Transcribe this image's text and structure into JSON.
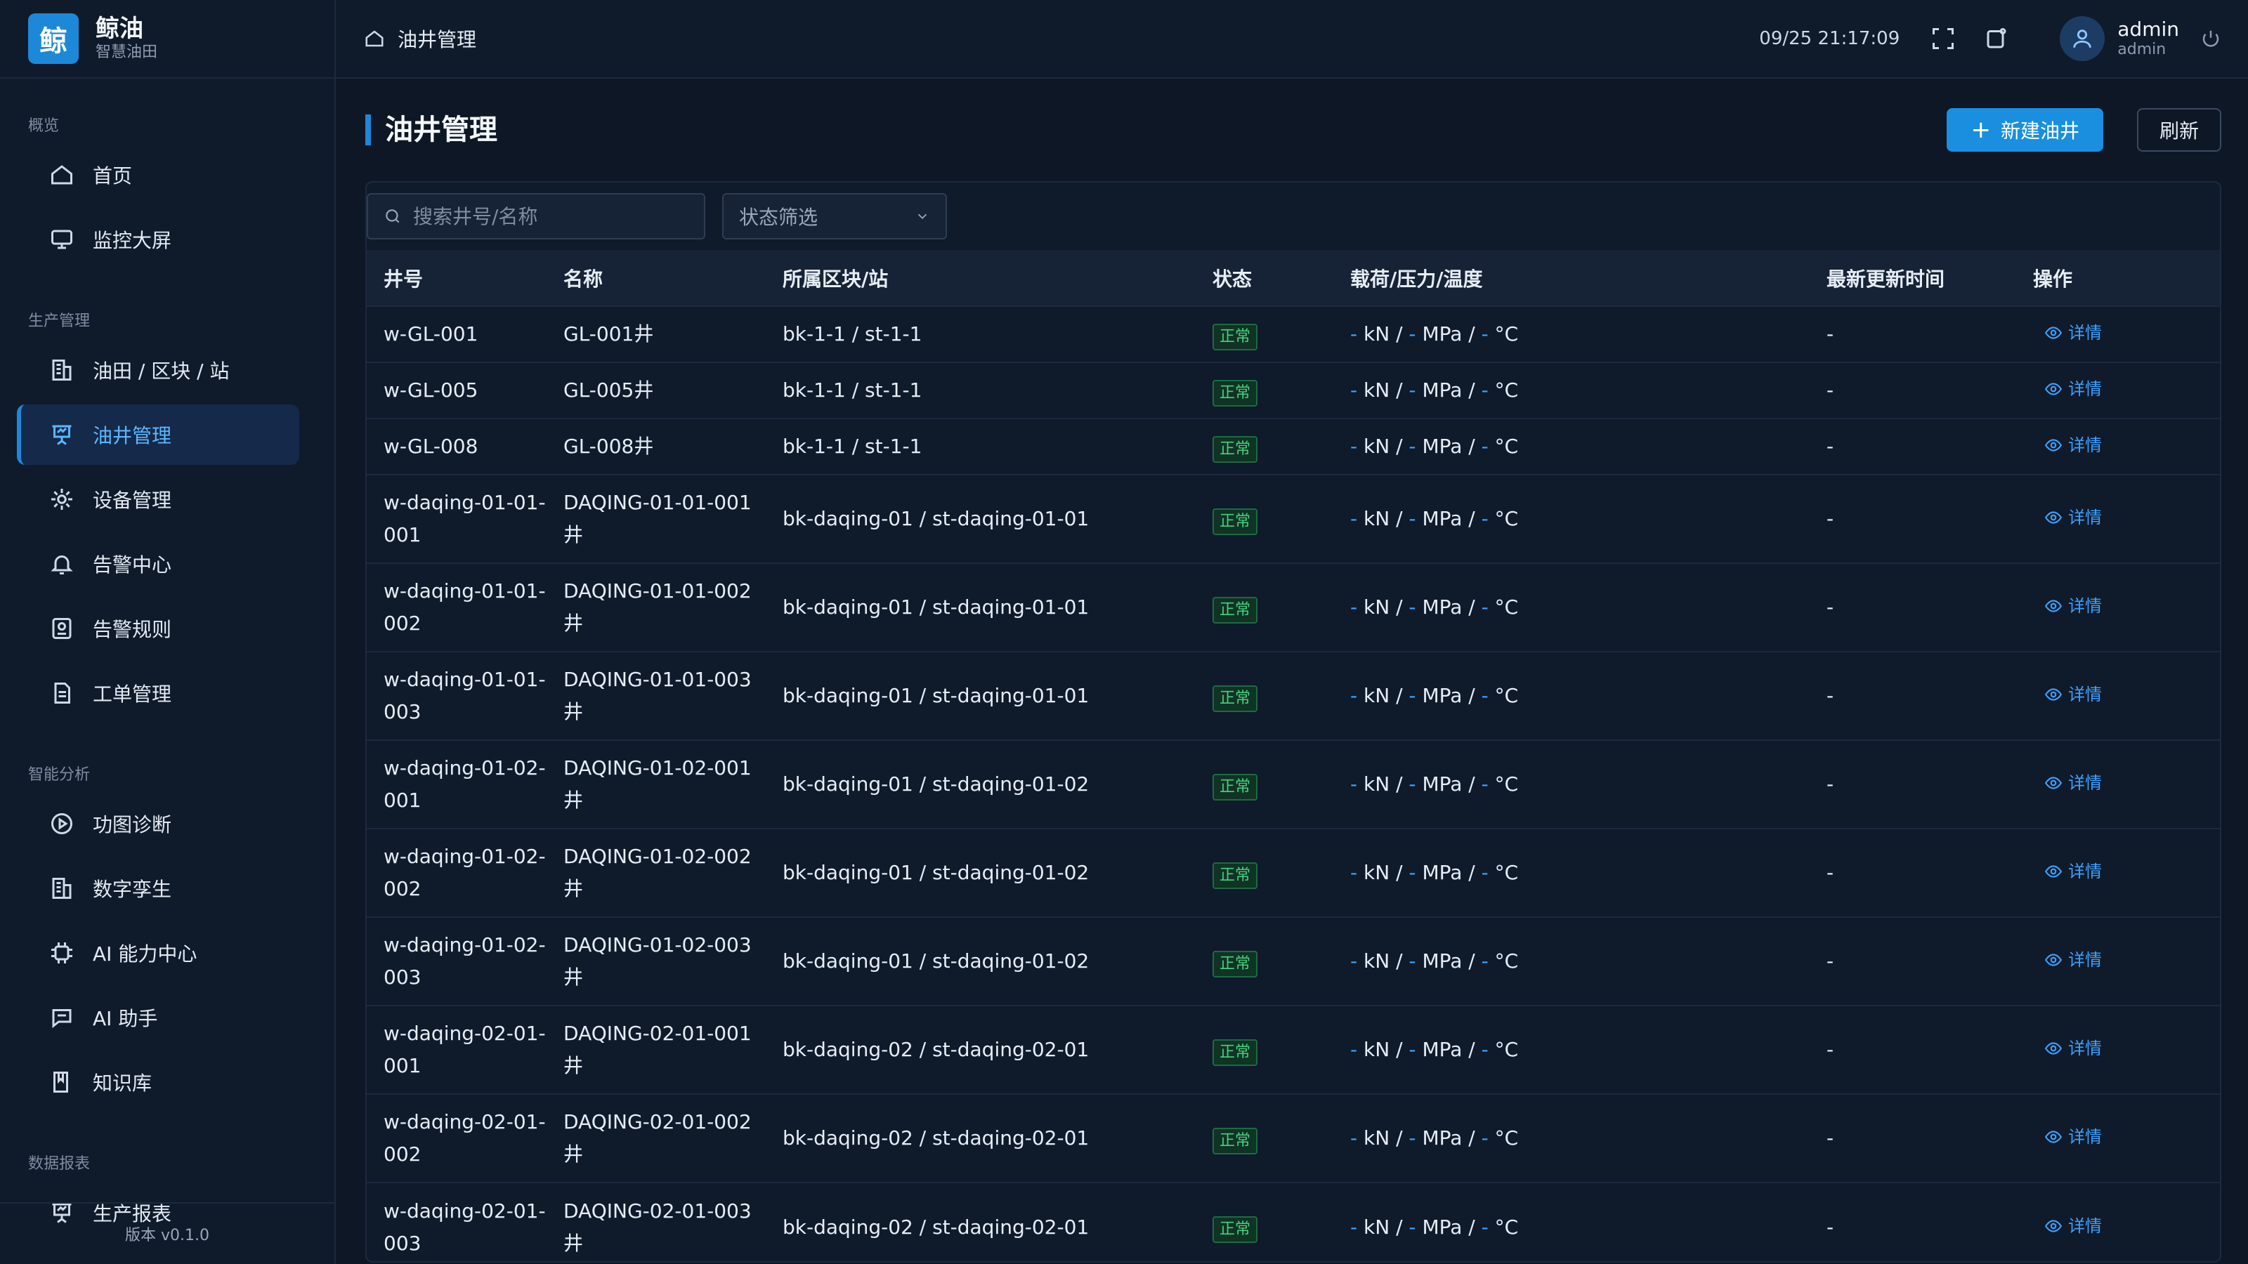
{
  "brand": {
    "logo": "鲸",
    "name": "鲸油",
    "subtitle": "智慧油田"
  },
  "sidebar": {
    "groups": [
      {
        "title": "概览",
        "items": [
          {
            "label": "首页",
            "icon": "home-icon"
          },
          {
            "label": "监控大屏",
            "icon": "monitor-icon"
          }
        ]
      },
      {
        "title": "生产管理",
        "items": [
          {
            "label": "油田 / 区块 / 站",
            "icon": "building-icon"
          },
          {
            "label": "油井管理",
            "icon": "presentation-icon",
            "active": true
          },
          {
            "label": "设备管理",
            "icon": "gear-icon"
          },
          {
            "label": "告警中心",
            "icon": "bell-icon"
          },
          {
            "label": "告警规则",
            "icon": "rules-icon"
          },
          {
            "label": "工单管理",
            "icon": "document-icon"
          }
        ]
      },
      {
        "title": "智能分析",
        "items": [
          {
            "label": "功图诊断",
            "icon": "play-circle-icon"
          },
          {
            "label": "数字孪生",
            "icon": "building-icon"
          },
          {
            "label": "AI 能力中心",
            "icon": "chip-icon"
          },
          {
            "label": "AI 助手",
            "icon": "chat-icon"
          },
          {
            "label": "知识库",
            "icon": "book-icon"
          }
        ]
      },
      {
        "title": "数据报表",
        "items": [
          {
            "label": "生产报表",
            "icon": "presentation-icon"
          }
        ]
      }
    ],
    "version": "版本 v0.1.0"
  },
  "topbar": {
    "breadcrumb": "油井管理",
    "clock": "09/25 21:17:09",
    "user_name": "admin",
    "user_role": "admin"
  },
  "page": {
    "title": "油井管理",
    "new_button": "新建油井",
    "refresh_button": "刷新",
    "search_placeholder": "搜索井号/名称",
    "status_filter": "状态筛选"
  },
  "table": {
    "headers": [
      "井号",
      "名称",
      "所属区块/站",
      "状态",
      "载荷/压力/温度",
      "最新更新时间",
      "操作"
    ],
    "metric": {
      "dash": "-",
      "kn": "kN /",
      "mpa": "MPa /",
      "c": "°C"
    },
    "detail_label": "详情",
    "rows": [
      {
        "id": "w-GL-001",
        "name": "GL-001井",
        "station": "bk-1-1 / st-1-1",
        "status": "正常",
        "updated": "-"
      },
      {
        "id": "w-GL-005",
        "name": "GL-005井",
        "station": "bk-1-1 / st-1-1",
        "status": "正常",
        "updated": "-"
      },
      {
        "id": "w-GL-008",
        "name": "GL-008井",
        "station": "bk-1-1 / st-1-1",
        "status": "正常",
        "updated": "-"
      },
      {
        "id": "w-daqing-01-01-001",
        "name": "DAQING-01-01-001井",
        "station": "bk-daqing-01 / st-daqing-01-01",
        "status": "正常",
        "updated": "-"
      },
      {
        "id": "w-daqing-01-01-002",
        "name": "DAQING-01-01-002井",
        "station": "bk-daqing-01 / st-daqing-01-01",
        "status": "正常",
        "updated": "-"
      },
      {
        "id": "w-daqing-01-01-003",
        "name": "DAQING-01-01-003井",
        "station": "bk-daqing-01 / st-daqing-01-01",
        "status": "正常",
        "updated": "-"
      },
      {
        "id": "w-daqing-01-02-001",
        "name": "DAQING-01-02-001井",
        "station": "bk-daqing-01 / st-daqing-01-02",
        "status": "正常",
        "updated": "-"
      },
      {
        "id": "w-daqing-01-02-002",
        "name": "DAQING-01-02-002井",
        "station": "bk-daqing-01 / st-daqing-01-02",
        "status": "正常",
        "updated": "-"
      },
      {
        "id": "w-daqing-01-02-003",
        "name": "DAQING-01-02-003井",
        "station": "bk-daqing-01 / st-daqing-01-02",
        "status": "正常",
        "updated": "-"
      },
      {
        "id": "w-daqing-02-01-001",
        "name": "DAQING-02-01-001井",
        "station": "bk-daqing-02 / st-daqing-02-01",
        "status": "正常",
        "updated": "-"
      },
      {
        "id": "w-daqing-02-01-002",
        "name": "DAQING-02-01-002井",
        "station": "bk-daqing-02 / st-daqing-02-01",
        "status": "正常",
        "updated": "-"
      },
      {
        "id": "w-daqing-02-01-003",
        "name": "DAQING-02-01-003井",
        "station": "bk-daqing-02 / st-daqing-02-01",
        "status": "正常",
        "updated": "-"
      }
    ]
  },
  "colors": {
    "accent": "#1a8fe0",
    "status_ok": "#48d17e",
    "background": "#0e1726"
  }
}
